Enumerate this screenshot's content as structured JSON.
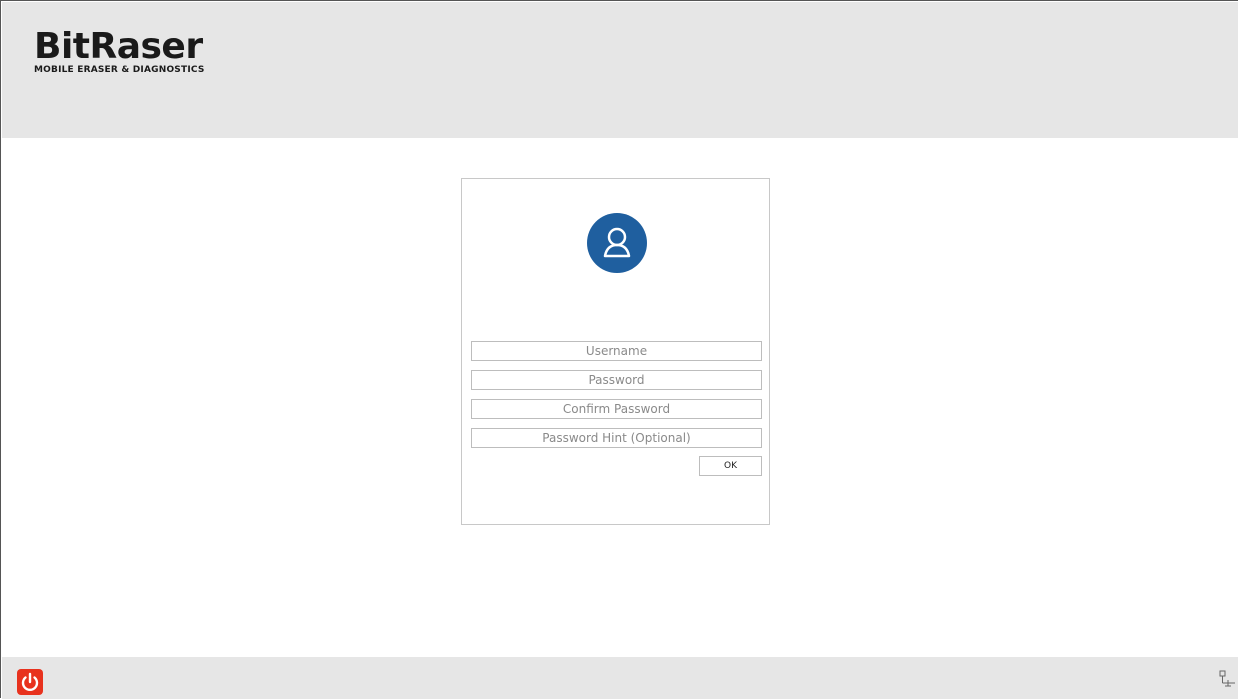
{
  "brand": {
    "name": "BitRaser",
    "tagline": "MOBILE ERASER & DIAGNOSTICS"
  },
  "form": {
    "username_placeholder": "Username",
    "password_placeholder": "Password",
    "confirm_placeholder": "Confirm Password",
    "hint_placeholder": "Password Hint (Optional)",
    "ok_label": "OK"
  },
  "icons": {
    "avatar": "user-avatar-icon",
    "power": "power-icon",
    "network": "network-icon"
  },
  "colors": {
    "accent": "#1f5f9f",
    "power": "#e8321e",
    "bar_bg": "#e6e6e6"
  }
}
